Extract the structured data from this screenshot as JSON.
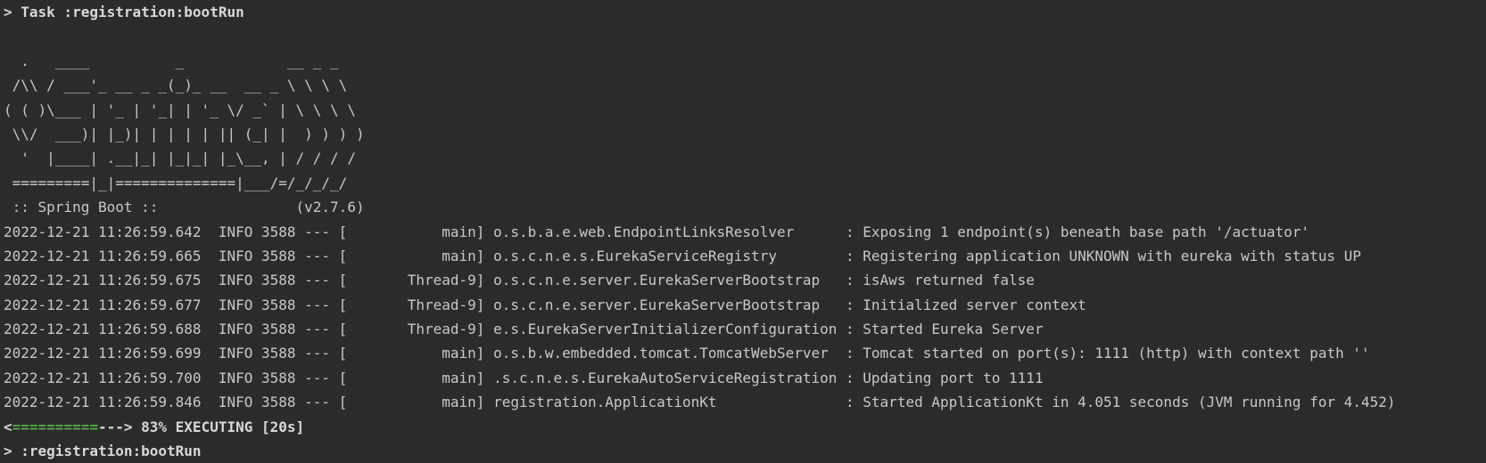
{
  "console": {
    "task_header": "> Task :registration:bootRun",
    "banner": [
      "  .   ____          _            __ _ _",
      " /\\\\ / ___'_ __ _ _(_)_ __  __ _ \\ \\ \\ \\",
      "( ( )\\___ | '_ | '_| | '_ \\/ _` | \\ \\ \\ \\",
      " \\\\/  ___)| |_)| | | | | || (_| |  ) ) ) )",
      "  '  |____| .__|_| |_|_| |_\\__, | / / / /",
      " =========|_|==============|___/=/_/_/_/",
      " :: Spring Boot ::                (v2.7.6)"
    ],
    "log_lines": [
      "2022-12-21 11:26:59.642  INFO 3588 --- [           main] o.s.b.a.e.web.EndpointLinksResolver      : Exposing 1 endpoint(s) beneath base path '/actuator'",
      "2022-12-21 11:26:59.665  INFO 3588 --- [           main] o.s.c.n.e.s.EurekaServiceRegistry        : Registering application UNKNOWN with eureka with status UP",
      "2022-12-21 11:26:59.675  INFO 3588 --- [       Thread-9] o.s.c.n.e.server.EurekaServerBootstrap   : isAws returned false",
      "2022-12-21 11:26:59.677  INFO 3588 --- [       Thread-9] o.s.c.n.e.server.EurekaServerBootstrap   : Initialized server context",
      "2022-12-21 11:26:59.688  INFO 3588 --- [       Thread-9] e.s.EurekaServerInitializerConfiguration : Started Eureka Server",
      "2022-12-21 11:26:59.699  INFO 3588 --- [           main] o.s.b.w.embedded.tomcat.TomcatWebServer  : Tomcat started on port(s): 1111 (http) with context path ''",
      "2022-12-21 11:26:59.700  INFO 3588 --- [           main] .s.c.n.e.s.EurekaAutoServiceRegistration : Updating port to 1111",
      "2022-12-21 11:26:59.846  INFO 3588 --- [           main] registration.ApplicationKt               : Started ApplicationKt in 4.051 seconds (JVM running for 4.452)"
    ],
    "progress": {
      "open_bracket": "<",
      "filled": "==========",
      "remaining": "--->",
      "status": " 83% EXECUTING [20s]",
      "percent": 83
    },
    "prompt_line": "> :registration:bootRun"
  },
  "colors": {
    "background": "#2b2b2b",
    "text": "#c8c8c8",
    "progress_fill": "#57a64a"
  }
}
